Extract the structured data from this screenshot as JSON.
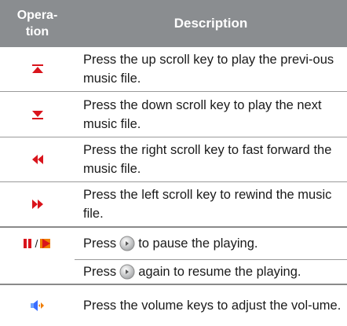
{
  "header": {
    "operation": "Opera-\ntion",
    "description": "Description"
  },
  "rows": [
    {
      "icon": "previous-track-icon",
      "text": "Press the up scroll key to play the previ-ous music file."
    },
    {
      "icon": "next-track-icon",
      "text": "Press the down scroll key to play the next music file."
    },
    {
      "icon": "fast-forward-icon",
      "text": "Press the right scroll key to fast forward the music file."
    },
    {
      "icon": "rewind-icon",
      "text": "Press the left scroll key to rewind the music file."
    },
    {
      "icon": "pause-play-icon",
      "separator": "/",
      "text_before": "Press",
      "text_after": "to pause the playing."
    },
    {
      "text_before": "Press",
      "text_after": "again to resume the playing.",
      "key_icon": "center-key-icon"
    },
    {
      "icon": "volume-icon",
      "text": "Press the volume keys to adjust the vol-ume."
    }
  ],
  "colors": {
    "header_bg": "#8a8d90",
    "icon_red": "#d9141c",
    "icon_orange": "#f07d00"
  }
}
